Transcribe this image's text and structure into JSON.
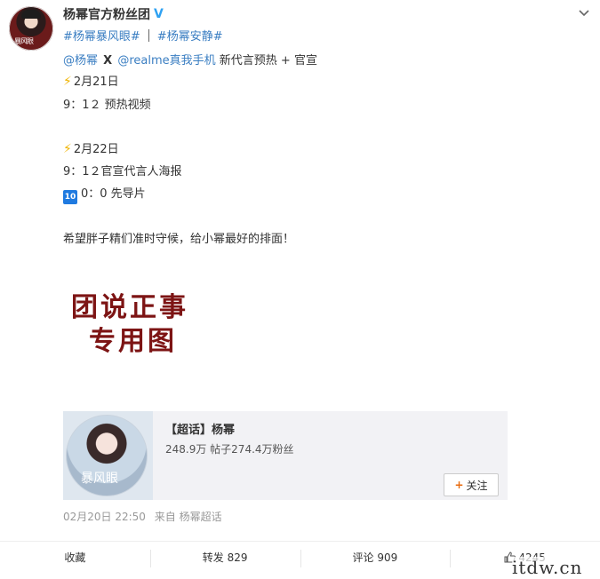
{
  "header": {
    "username": "杨幂官方粉丝团",
    "verified_icon": "verified-v-icon",
    "menu_icon": "chevron-down-icon"
  },
  "hashtags": [
    "#杨幂暴风眼#",
    "#杨幂安静#"
  ],
  "post": {
    "mention1": "@杨幂",
    "x_symbol": "X",
    "mention2": "@realme真我手机",
    "line1_text": " 新代言预热 + 官宣",
    "date1": "2月21日",
    "time1": "9：1２ 预热视频",
    "date2": "2月22日",
    "time2": "9：1２官宣代言人海报",
    "ten_icon": "10",
    "time3": "0：0 先导片",
    "closing": "希望胖子精们准时守候，给小幂最好的排面！"
  },
  "image_text": {
    "line1": "团说正事",
    "line2": "专用图"
  },
  "card": {
    "title": "【超话】杨幂",
    "stats": "248.9万 帖子274.4万粉丝",
    "follow_label": "关注",
    "cover_text": "暴风眼"
  },
  "meta": {
    "timestamp": "02月20日 22:50",
    "source": "来自 杨幂超话"
  },
  "actions": {
    "favorite": "收藏",
    "repost": "转发 829",
    "comment": "评论 909",
    "like": "4245"
  },
  "watermark": "itdw.cn",
  "colors": {
    "link": "#3a7ec2",
    "stamp": "#7d1414",
    "card_bg": "#f2f2f5"
  }
}
